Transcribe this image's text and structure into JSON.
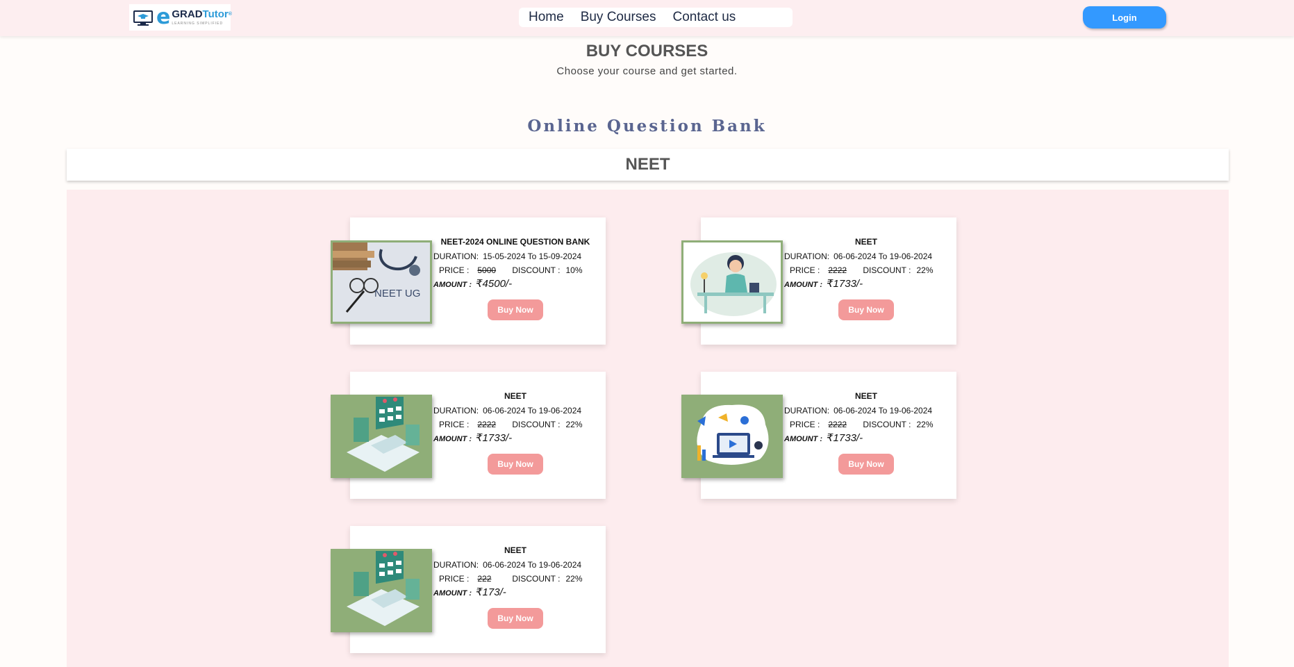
{
  "header": {
    "logo": {
      "e": "e",
      "grad": "GRAD",
      "tutor": "Tutor",
      "reg": "®",
      "tagline": "LEARNING SIMPLIFIED"
    },
    "nav": [
      "Home",
      "Buy Courses",
      "Contact us"
    ],
    "login_label": "Login"
  },
  "page": {
    "title": "BUY COURSES",
    "subtitle": "Choose your course and get started."
  },
  "section_title": "Online Question Bank",
  "category": "NEET",
  "labels": {
    "duration": "DURATION:",
    "to": "To",
    "price": "PRICE :",
    "discount": "DISCOUNT :",
    "amount": "AMOUNT :",
    "buy_now": "Buy Now"
  },
  "courses": [
    {
      "title": "NEET-2024 ONLINE QUESTION BANK",
      "start": "15-05-2024",
      "end": "15-09-2024",
      "price": "5000",
      "discount": "10%",
      "amount": "₹4500/-",
      "thumb": "stethoscope-books-image",
      "thumb_text": "NEET UG"
    },
    {
      "title": "NEET",
      "start": "06-06-2024",
      "end": "19-06-2024",
      "price": "2222",
      "discount": "22%",
      "amount": "₹1733/-",
      "thumb": "woman-studying-image"
    },
    {
      "title": "NEET",
      "start": "06-06-2024",
      "end": "19-06-2024",
      "price": "2222",
      "discount": "22%",
      "amount": "₹1733/-",
      "thumb": "laptop-dashboard-image"
    },
    {
      "title": "NEET",
      "start": "06-06-2024",
      "end": "19-06-2024",
      "price": "2222",
      "discount": "22%",
      "amount": "₹1733/-",
      "thumb": "online-video-image"
    },
    {
      "title": "NEET",
      "start": "06-06-2024",
      "end": "19-06-2024",
      "price": "222",
      "discount": "22%",
      "amount": "₹173/-",
      "thumb": "laptop-dashboard-image"
    }
  ],
  "colors": {
    "header_bg": "#fdeef0",
    "login_bg": "#3399ff",
    "buy_btn": "#f39a9a",
    "thumb_border": "#8fae78",
    "section_title": "#5a6590"
  }
}
